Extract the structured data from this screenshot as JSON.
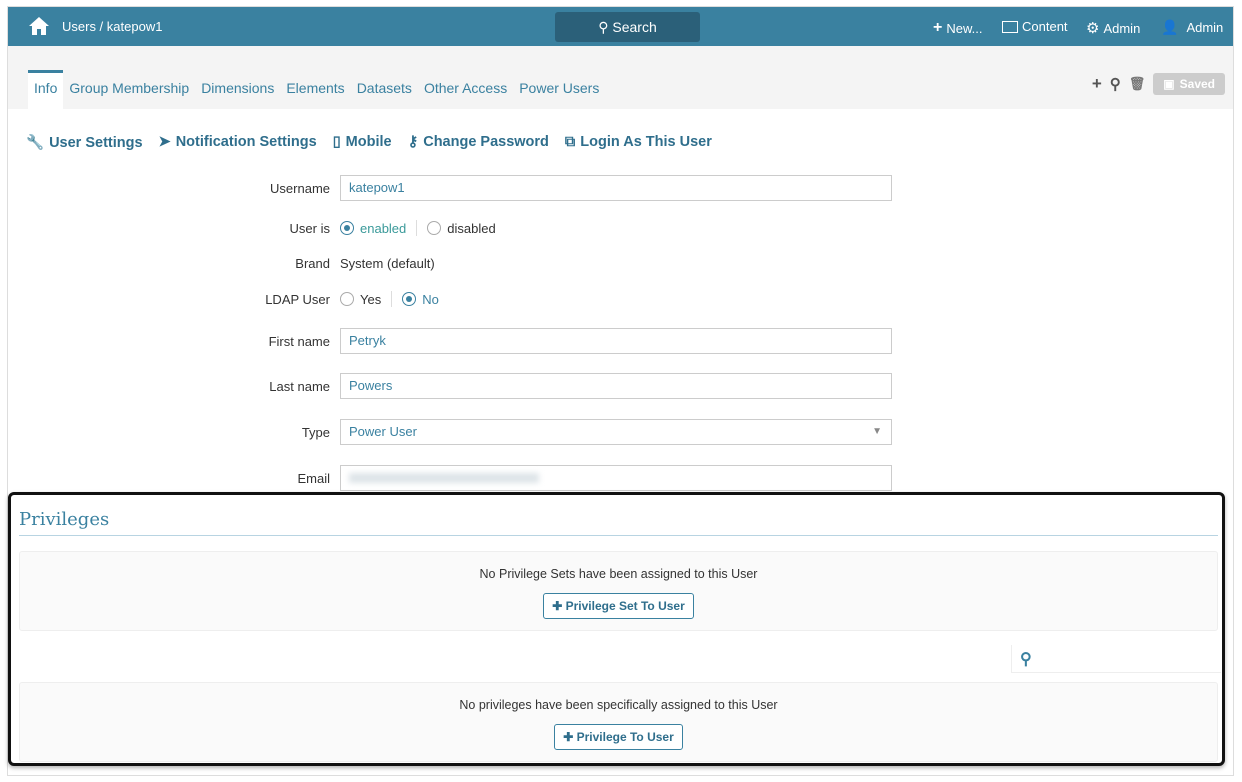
{
  "topbar": {
    "breadcrumb": "Users / katepow1",
    "search_label": "Search",
    "new_label": "New...",
    "content_label": "Content",
    "admin_label": "Admin",
    "user_label": "Admin"
  },
  "tabs": [
    "Info",
    "Group Membership",
    "Dimensions",
    "Elements",
    "Datasets",
    "Other Access",
    "Power Users"
  ],
  "toolbar": {
    "saved_label": "Saved"
  },
  "links": [
    "User Settings",
    "Notification Settings",
    "Mobile",
    "Change Password",
    "Login As This User"
  ],
  "form": {
    "username_label": "Username",
    "username": "katepow1",
    "user_is_label": "User is",
    "enabled": "enabled",
    "disabled": "disabled",
    "status": "enabled",
    "brand_label": "Brand",
    "brand": "System (default)",
    "ldap_label": "LDAP User",
    "yes": "Yes",
    "no": "No",
    "ldap": "No",
    "first_name_label": "First name",
    "first_name": "Petryk",
    "last_name_label": "Last name",
    "last_name": "Powers",
    "type_label": "Type",
    "type": "Power User",
    "email_label": "Email"
  },
  "privileges": {
    "title": "Privileges",
    "sets_message": "No Privilege Sets have been assigned to this User",
    "add_set_label": "Privilege Set To User",
    "priv_message": "No privileges have been specifically assigned to this User",
    "add_priv_label": "Privilege To User"
  },
  "colors": {
    "brand": "#3a81a0"
  }
}
